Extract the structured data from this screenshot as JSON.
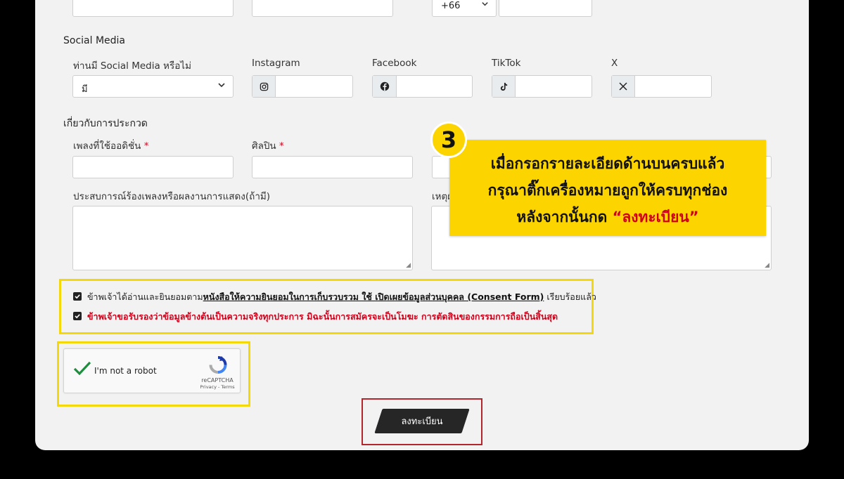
{
  "phone": {
    "country_code": "+66"
  },
  "social": {
    "section_title": "Social Media",
    "has_social_label": "ท่านมี Social Media หรือไม่",
    "has_social_value": "มี",
    "instagram_label": "Instagram",
    "facebook_label": "Facebook",
    "tiktok_label": "TikTok",
    "x_label": "X"
  },
  "contest": {
    "section_title": "เกี่ยวกับการประกวด",
    "song_label": "เพลงที่ใช้ออดิชั่น",
    "artist_label": "ศิลปิน",
    "required_mark": "*",
    "experience_label": "ประสบการณ์ร้องเพลงหรือผลงานการแสดง(ถ้ามี)",
    "reason_label": "เหตุผ"
  },
  "consent": {
    "line1_prefix": "ข้าพเจ้าได้อ่านและยินยอมตาม",
    "line1_link": "หนังสือให้ความยินยอมในการเก็บรวบรวม ใช้ เปิดเผยข้อมูลส่วนบุคคล (Consent Form)",
    "line1_suffix": " เรียบร้อยแล้ว",
    "line2": "ข้าพเจ้าขอรับรองว่าข้อมูลข้างต้นเป็นความจริงทุกประการ มิฉะนั้นการสมัครจะเป็นโมฆะ การตัดสินของกรรมการถือเป็นสิ้นสุด"
  },
  "captcha": {
    "label": "I'm not a robot",
    "brand": "reCAPTCHA",
    "links": "Privacy - Terms"
  },
  "submit_label": "ลงทะเบียน",
  "callout": {
    "step": "3",
    "line1": "เมื่อกรอกรายละเอียดด้านบนครบแล้ว",
    "line2": "กรุณาติ๊กเครื่องหมายถูกให้ครบทุกช่อง",
    "line3_prefix": "หลังจากนั้นกด ",
    "line3_highlight": "“ลงทะเบียน”"
  },
  "colors": {
    "highlight_yellow": "#f5d80b",
    "callout_yellow": "#fcd400",
    "required_red": "#d0021b",
    "submit_outline": "#b3262d",
    "submit_bg": "#262626"
  }
}
